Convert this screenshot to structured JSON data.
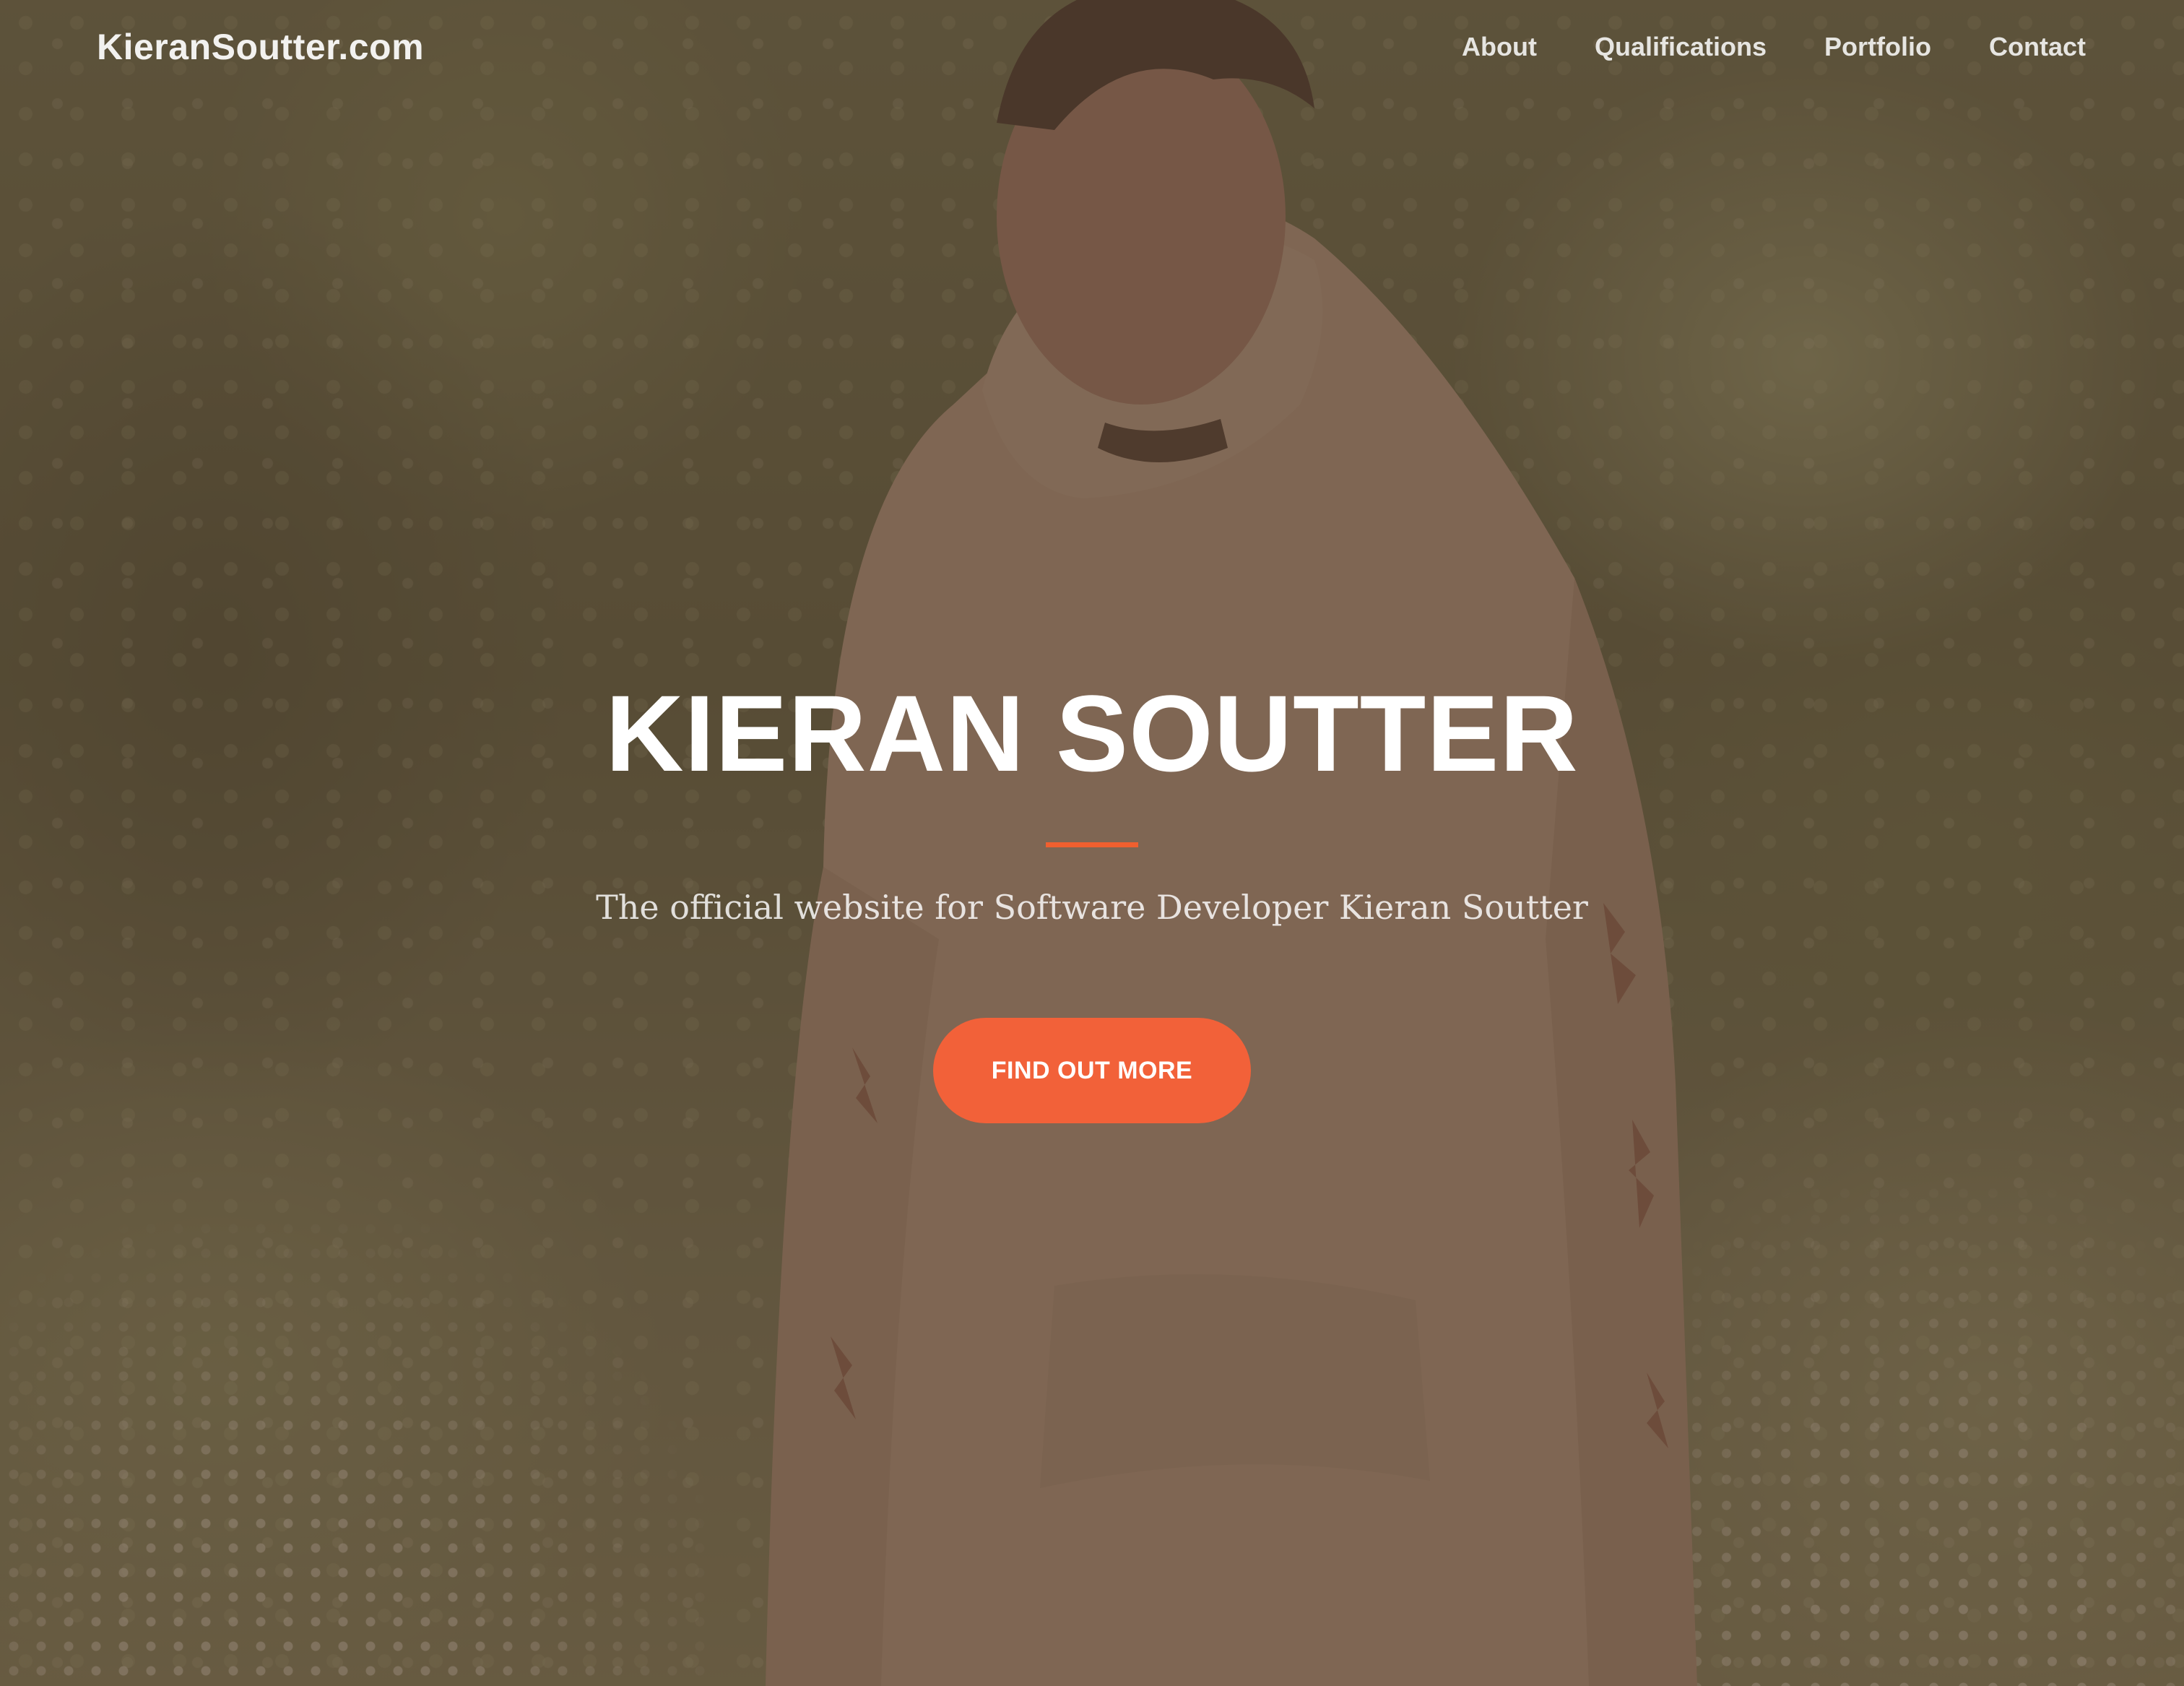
{
  "nav": {
    "brand": "KieranSoutter.com",
    "links": [
      "About",
      "Qualifications",
      "Portfolio",
      "Contact"
    ]
  },
  "hero": {
    "title": "KIERAN SOUTTER",
    "subtitle": "The official website for Software Developer Kieran Soutter",
    "cta_label": "FIND OUT MORE"
  },
  "colors": {
    "accent": "#f26139",
    "overlay": "#5c4434",
    "text": "#ffffff"
  },
  "background": {
    "icon": "hero-photo"
  }
}
